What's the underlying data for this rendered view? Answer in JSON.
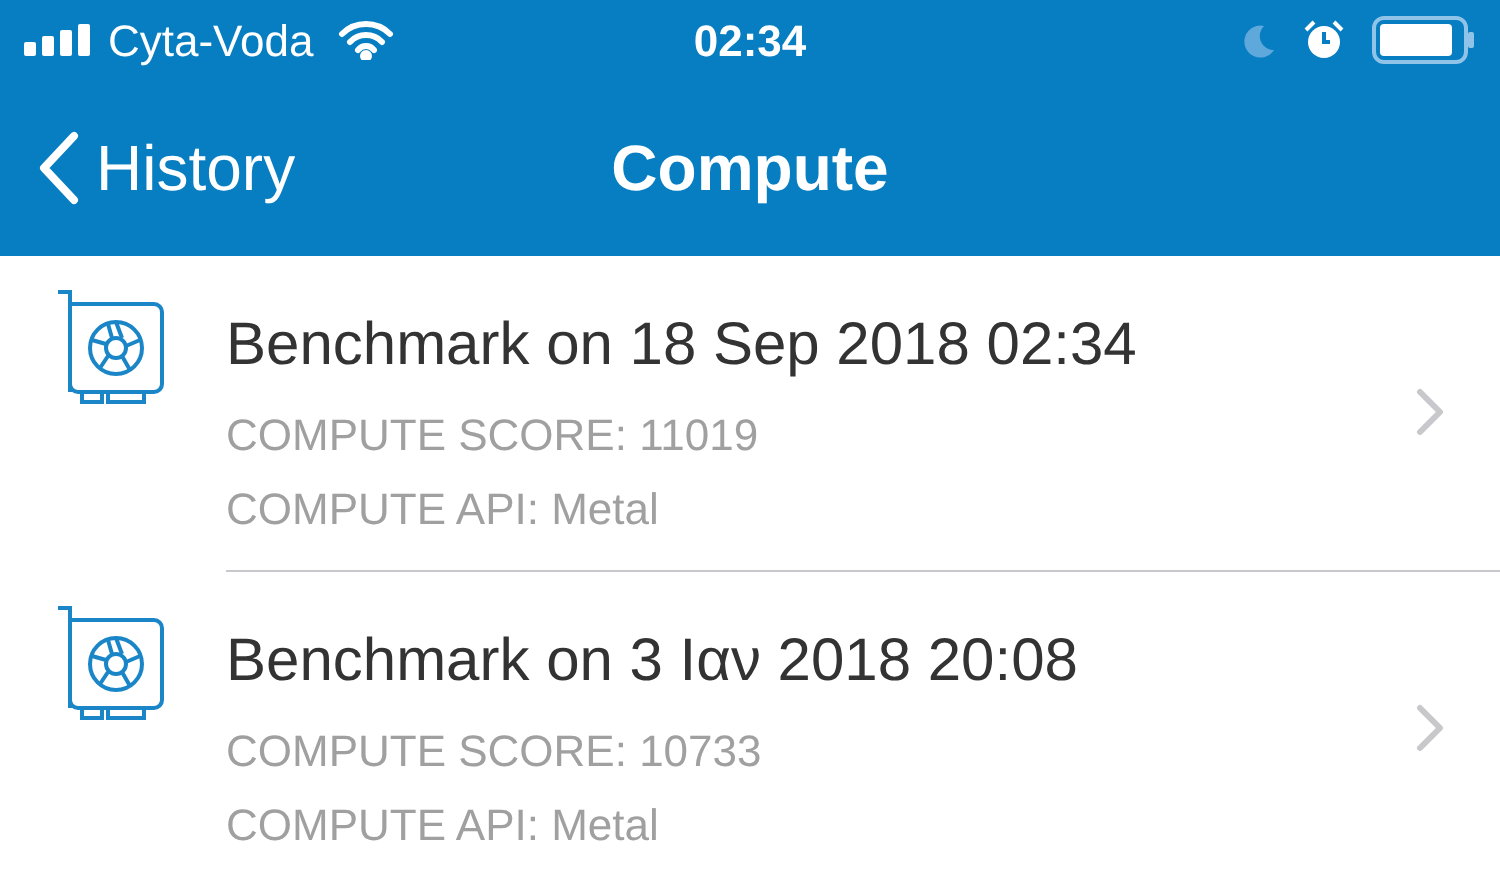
{
  "status_bar": {
    "carrier": "Cyta-Voda",
    "time": "02:34"
  },
  "nav": {
    "back": "History",
    "title": "Compute"
  },
  "rows": [
    {
      "title": "Benchmark on 18 Sep 2018 02:34",
      "lines": [
        "COMPUTE SCORE: 11019",
        "COMPUTE API: Metal"
      ]
    },
    {
      "title": "Benchmark on 3 Ιαν 2018 20:08",
      "lines": [
        "COMPUTE SCORE: 10733",
        "COMPUTE API: Metal"
      ]
    }
  ]
}
